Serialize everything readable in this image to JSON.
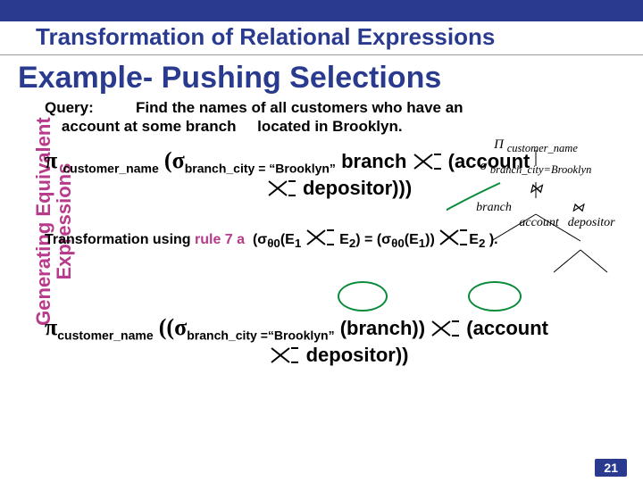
{
  "chapter_title": "Transformation of Relational Expressions",
  "slide_title": "Example- Pushing Selections",
  "sidebar": "Generating Equivalent Expressions",
  "query": {
    "label": "Query:",
    "text_part1": "Find the names of all customers who have an",
    "text_part2": "account at some branch",
    "text_part3": "located in Brooklyn."
  },
  "expr1": {
    "pi": "π",
    "pi_sub": "customer_name",
    "lparen": "(",
    "sigma": "σ",
    "sigma_sub": "branch_city = “Brooklyn”",
    "rel1": "branch",
    "rel2": "(account",
    "rel3": "depositor)))"
  },
  "transform": {
    "prefix": "Transformation using ",
    "rule": "rule 7 a",
    "formula_a": "(σ",
    "theta0a": "θ0",
    "e1a": "(E",
    "one": "1",
    "e2": "E",
    "two": "2",
    "eq": ") = (σ",
    "e1b": "(E",
    "close": ")."
  },
  "expr2": {
    "pi": "π",
    "pi_sub": "customer_name",
    "llparen": "((",
    "sigma": "σ",
    "sigma_sub": "branch_city =“Brooklyn”",
    "rel1": "(branch))",
    "rel2": "(account",
    "rel3": "depositor))"
  },
  "diagram": {
    "top": "Π",
    "top_sub": "customer_name",
    "sigma": "σ",
    "sigma_sub": "branch_city=Brooklyn",
    "join": "⋈",
    "leaf1": "branch",
    "leaf2": "account",
    "leaf3": "depositor"
  },
  "page_number": "21"
}
